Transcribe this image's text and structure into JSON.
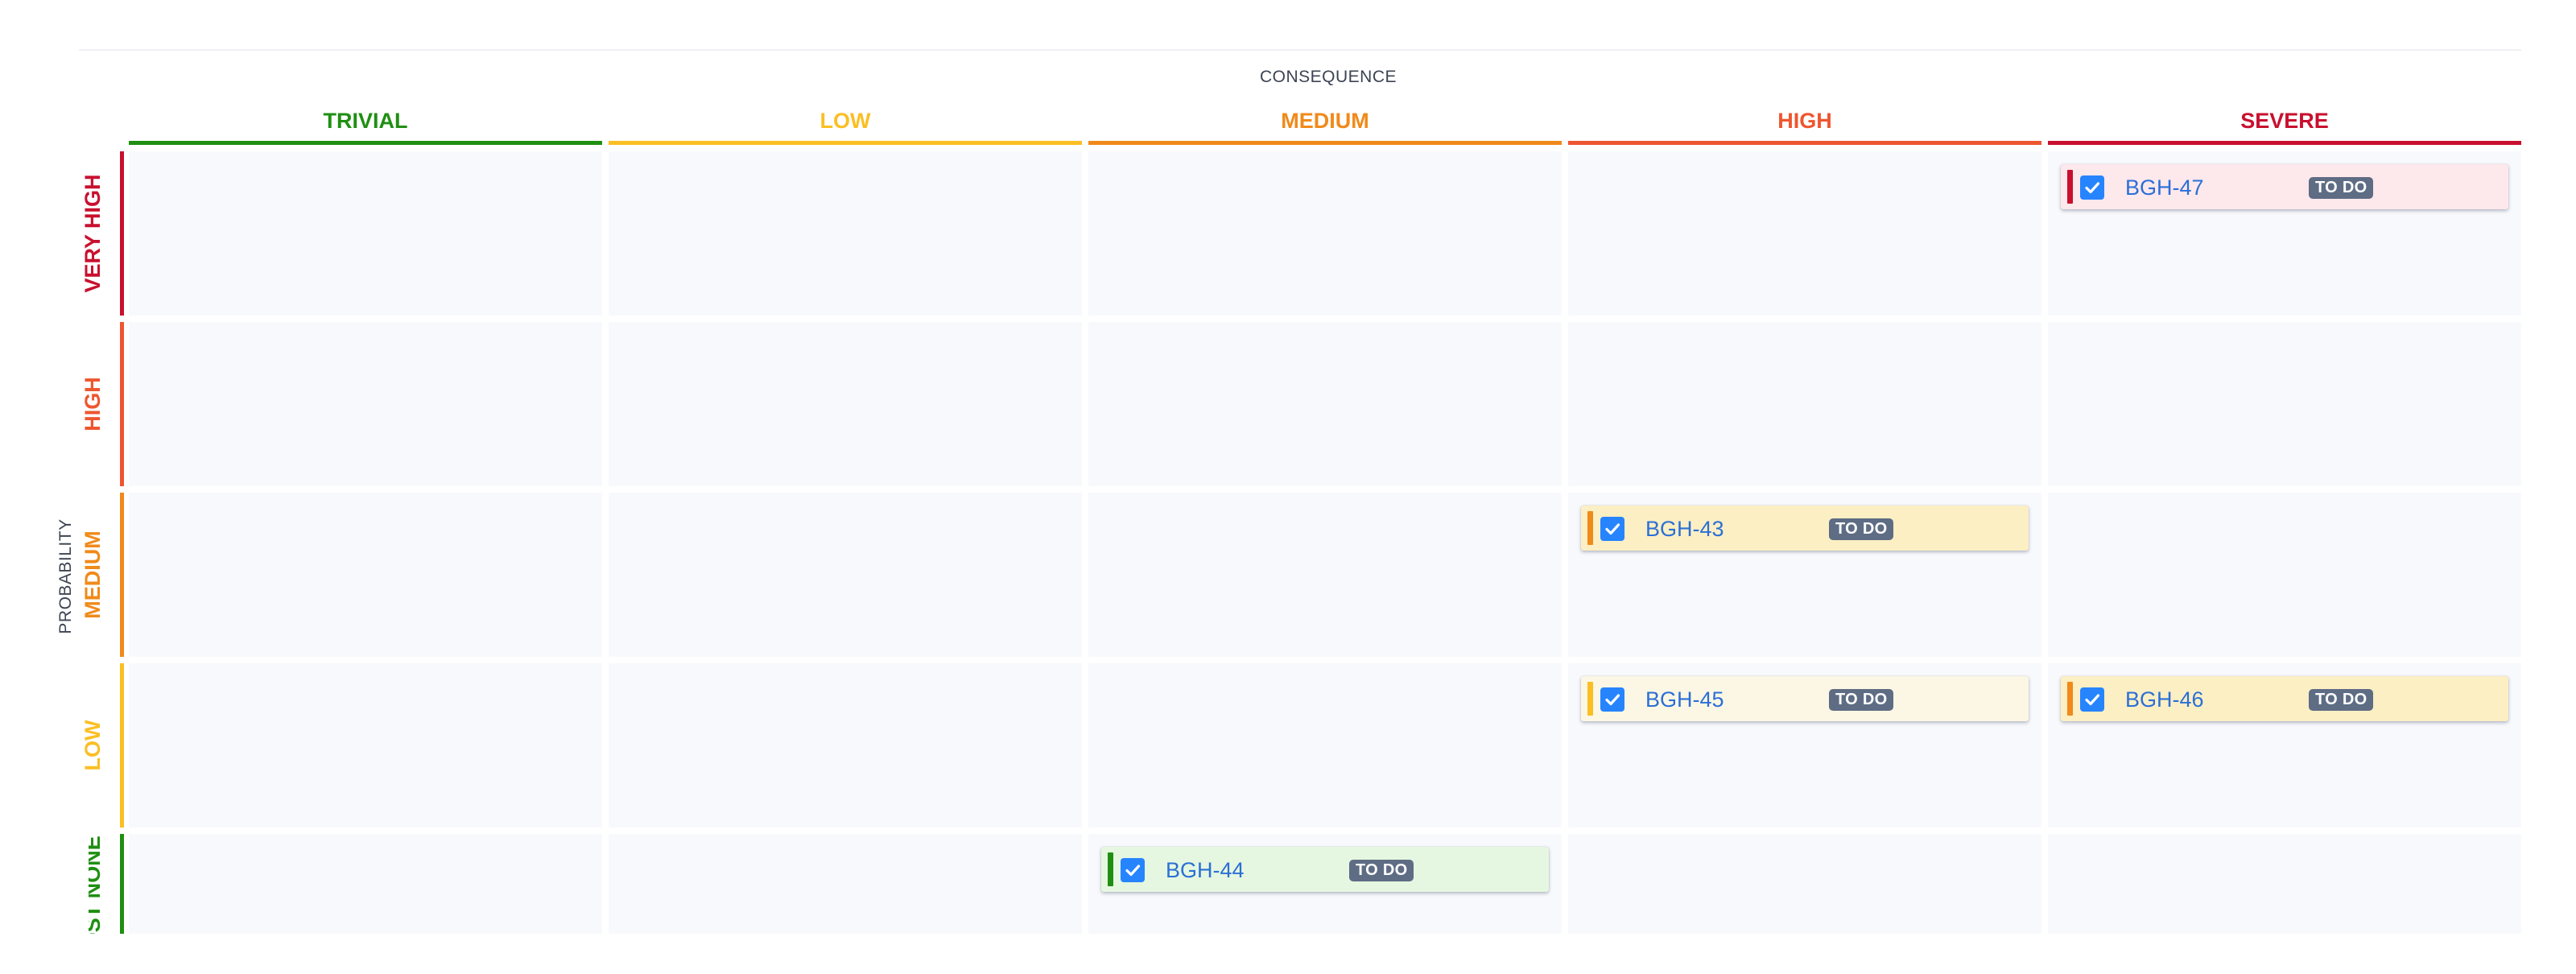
{
  "matrix": {
    "x_axis_title": "CONSEQUENCE",
    "y_axis_title": "PROBABILITY",
    "columns": [
      {
        "label": "TRIVIAL",
        "color": "#1f8f12"
      },
      {
        "label": "LOW",
        "color": "#fbbf24"
      },
      {
        "label": "MEDIUM",
        "color": "#f08a1a"
      },
      {
        "label": "HIGH",
        "color": "#ee5630"
      },
      {
        "label": "SEVERE",
        "color": "#c8102e"
      }
    ],
    "rows": [
      {
        "label": "VERY HIGH",
        "color": "#c8102e"
      },
      {
        "label": "HIGH",
        "color": "#ee5630"
      },
      {
        "label": "MEDIUM",
        "color": "#f08a1a"
      },
      {
        "label": "LOW",
        "color": "#fbbf24"
      },
      {
        "label": "ALMOST NONE",
        "color": "#1f8f12"
      }
    ],
    "cell_background": "#f8f9fc"
  },
  "cards": [
    {
      "key": "BGH-47",
      "status": "TO DO",
      "probability": "VERY HIGH",
      "consequence": "SEVERE",
      "row": 0,
      "col": 4,
      "accent": "#c8102e",
      "background": "#fde8ec",
      "icon": "task-checkbox-icon"
    },
    {
      "key": "BGH-43",
      "status": "TO DO",
      "probability": "MEDIUM",
      "consequence": "HIGH",
      "row": 2,
      "col": 3,
      "accent": "#f08a1a",
      "background": "#fcefc4",
      "icon": "task-checkbox-icon"
    },
    {
      "key": "BGH-45",
      "status": "TO DO",
      "probability": "LOW",
      "consequence": "HIGH",
      "row": 3,
      "col": 3,
      "accent": "#fbbf24",
      "background": "#fcf7e4",
      "icon": "task-checkbox-icon"
    },
    {
      "key": "BGH-46",
      "status": "TO DO",
      "probability": "LOW",
      "consequence": "SEVERE",
      "row": 3,
      "col": 4,
      "accent": "#f08a1a",
      "background": "#fcefc4",
      "icon": "task-checkbox-icon"
    },
    {
      "key": "BGH-44",
      "status": "TO DO",
      "probability": "ALMOST NONE",
      "consequence": "MEDIUM",
      "row": 4,
      "col": 2,
      "accent": "#1f8f12",
      "background": "#e5f7e0",
      "icon": "task-checkbox-icon"
    }
  ]
}
